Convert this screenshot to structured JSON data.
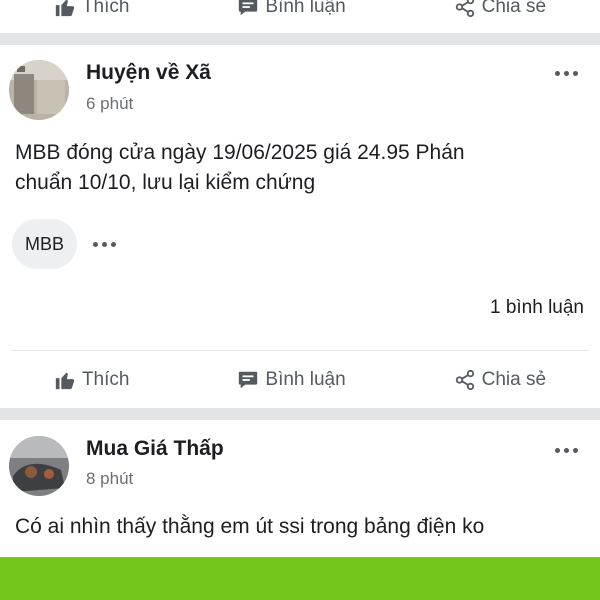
{
  "actions": {
    "like": "Thích",
    "comment": "Bình luận",
    "share": "Chia sẻ"
  },
  "posts": [
    {
      "author": "Huyện về Xã",
      "time": "6 phút",
      "text_line1": "MBB đóng cửa ngày 19/06/2025 giá 24.95 Phán",
      "text_line2": "chuẩn 10/10, lưu lại kiểm chứng",
      "tag": "MBB",
      "comment_count": "1 bình luận"
    },
    {
      "author": "Mua Giá Thấp",
      "time": "8 phút",
      "text_line1": "Có ai nhìn thấy thằng em út ssi trong bảng điện ko"
    }
  ],
  "colors": {
    "accent_green": "#74c61a",
    "separator": "#e3e4e6",
    "icon_gray": "#555a61"
  },
  "icons": [
    "like-icon",
    "comment-icon",
    "share-icon",
    "more-options-icon"
  ]
}
